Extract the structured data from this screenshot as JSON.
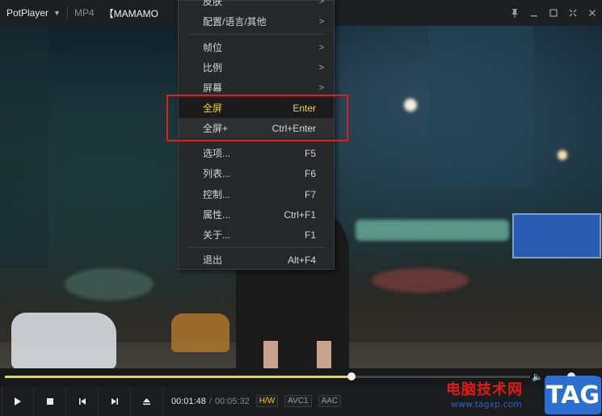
{
  "titlebar": {
    "app_name": "PotPlayer",
    "format": "MP4",
    "video_title": "【MAMAMO"
  },
  "menu": {
    "items": [
      {
        "label": "皮肤",
        "shortcut": "",
        "submenu": true
      },
      {
        "label": "配置/语言/其他",
        "shortcut": "",
        "submenu": true
      },
      {
        "label": "帧位",
        "shortcut": "",
        "submenu": true
      },
      {
        "label": "比例",
        "shortcut": "",
        "submenu": true
      },
      {
        "label": "屏幕",
        "shortcut": "",
        "submenu": true
      },
      {
        "label": "全屏",
        "shortcut": "Enter",
        "submenu": false
      },
      {
        "label": "全屏+",
        "shortcut": "Ctrl+Enter",
        "submenu": false
      },
      {
        "label": "选项...",
        "shortcut": "F5",
        "submenu": false
      },
      {
        "label": "列表...",
        "shortcut": "F6",
        "submenu": false
      },
      {
        "label": "控制...",
        "shortcut": "F7",
        "submenu": false
      },
      {
        "label": "属性...",
        "shortcut": "Ctrl+F1",
        "submenu": false
      },
      {
        "label": "关于...",
        "shortcut": "F1",
        "submenu": false
      },
      {
        "label": "退出",
        "shortcut": "Alt+F4",
        "submenu": false
      }
    ],
    "submenu_arrow": ">"
  },
  "playback": {
    "current_time": "00:01:48",
    "separator": "/",
    "total_time": "00:05:32",
    "progress_fraction": 0.66,
    "volume_fraction": 0.5
  },
  "badges": {
    "hw": "H/W",
    "video_codec": "AVC1",
    "audio_codec": "AAC"
  },
  "watermark": {
    "text": "电脑技术网",
    "url": "www.tagxp.com",
    "logo": "TAG"
  },
  "icons": {
    "play": "play-icon",
    "stop": "stop-icon",
    "prev": "previous-icon",
    "next": "next-icon",
    "eject": "eject-icon"
  },
  "colors": {
    "accent": "#e9d54a",
    "highlight_text": "#f2d43a",
    "annotation_box": "#e21d1d"
  }
}
